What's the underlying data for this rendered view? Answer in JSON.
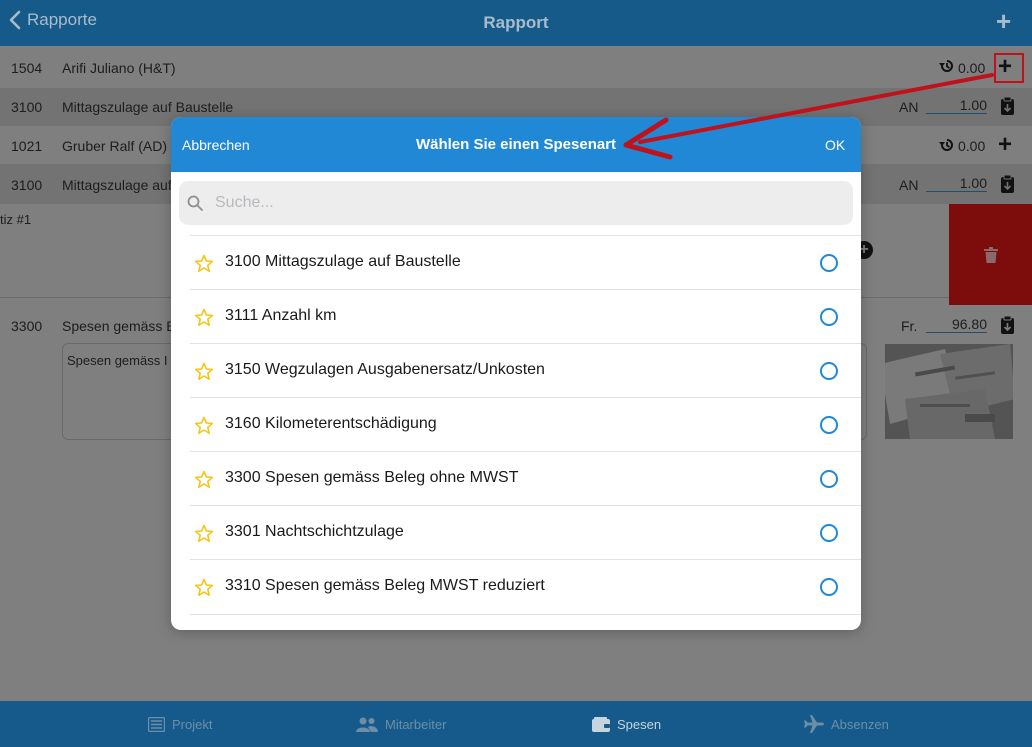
{
  "topbar": {
    "back_label": "Rapporte",
    "title": "Rapport"
  },
  "rows": [
    {
      "code": "1504",
      "name": "Arifi Juliano (H&T)",
      "value": "0.00"
    },
    {
      "code": "3100",
      "name": "Mittagszulage auf Baustelle",
      "unit": "AN",
      "value": "1.00"
    },
    {
      "code": "1021",
      "name": "Gruber Ralf (AD)",
      "value": "0.00"
    },
    {
      "code": "3100",
      "name": "Mittagszulage auf",
      "unit": "AN",
      "value": "1.00"
    },
    {
      "code": "3300",
      "name": "Spesen gemäss B",
      "unit": "Fr.",
      "value": "96.80"
    }
  ],
  "notiz_label": "tiz #1",
  "note_text": "Spesen gemäss I",
  "modal": {
    "cancel_label": "Abbrechen",
    "title": "Wählen Sie einen Spesenart",
    "ok_label": "OK",
    "search_placeholder": "Suche...",
    "items": [
      {
        "label": "3100 Mittagszulage auf Baustelle"
      },
      {
        "label": "3111 Anzahl km"
      },
      {
        "label": "3150 Wegzulagen Ausgabenersatz/Unkosten"
      },
      {
        "label": "3160 Kilometerentschädigung"
      },
      {
        "label": "3300 Spesen gemäss Beleg ohne MWST"
      },
      {
        "label": "3301 Nachtschichtzulage"
      },
      {
        "label": "3310 Spesen gemäss Beleg MWST reduziert"
      }
    ]
  },
  "tabs": [
    {
      "label": "Projekt"
    },
    {
      "label": "Mitarbeiter"
    },
    {
      "label": "Spesen"
    },
    {
      "label": "Absenzen"
    }
  ],
  "colors": {
    "accent": "#2188d6",
    "header": "#165a8a",
    "annotation": "#c0121b",
    "star": "#f5c518"
  }
}
